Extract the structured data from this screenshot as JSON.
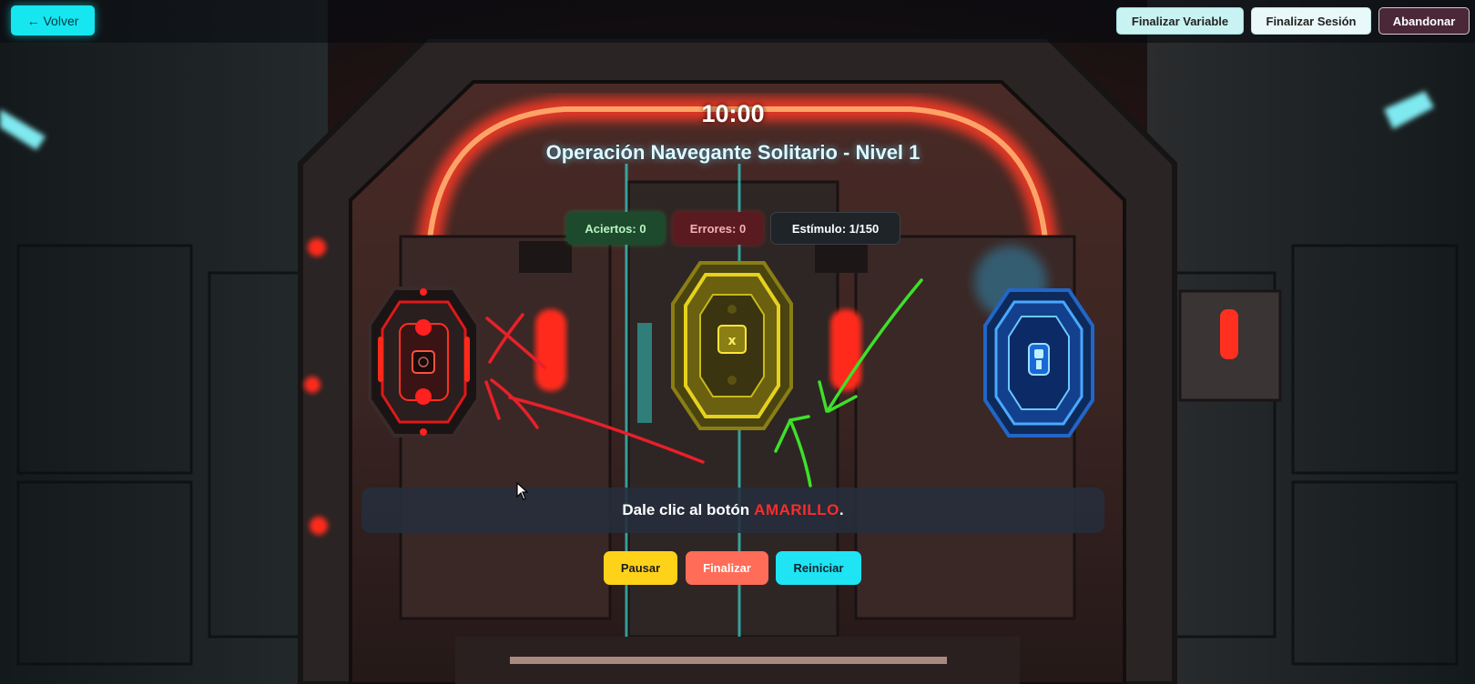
{
  "topbar": {
    "back_label": "← Volver",
    "finalize_variable_label": "Finalizar Variable",
    "finalize_session_label": "Finalizar Sesión",
    "abandon_label": "Abandonar"
  },
  "game": {
    "timer": "10:00",
    "title": "Operación Navegante Solitario - Nivel 1",
    "stats": {
      "hits": "Aciertos: 0",
      "errors": "Errores: 0",
      "stimulus": "Estímulo: 1/150"
    },
    "buttons": [
      {
        "color_name": "red",
        "hex": "#e01818",
        "symbol": ""
      },
      {
        "color_name": "yellow",
        "hex": "#d9c81a",
        "symbol": "x"
      },
      {
        "color_name": "blue",
        "hex": "#1a7bff",
        "symbol": ""
      }
    ],
    "instruction": {
      "prefix": "Dale clic al botón",
      "color_word": "AMARILLO",
      "suffix": ".",
      "color_word_color": "#ff2b2b"
    },
    "controls": {
      "pause_label": "Pausar",
      "finish_label": "Finalizar",
      "restart_label": "Reiniciar"
    }
  },
  "colors": {
    "accent_cyan": "#15e6f0",
    "annotation_red": "#e8202a",
    "annotation_green": "#3ee02a"
  }
}
